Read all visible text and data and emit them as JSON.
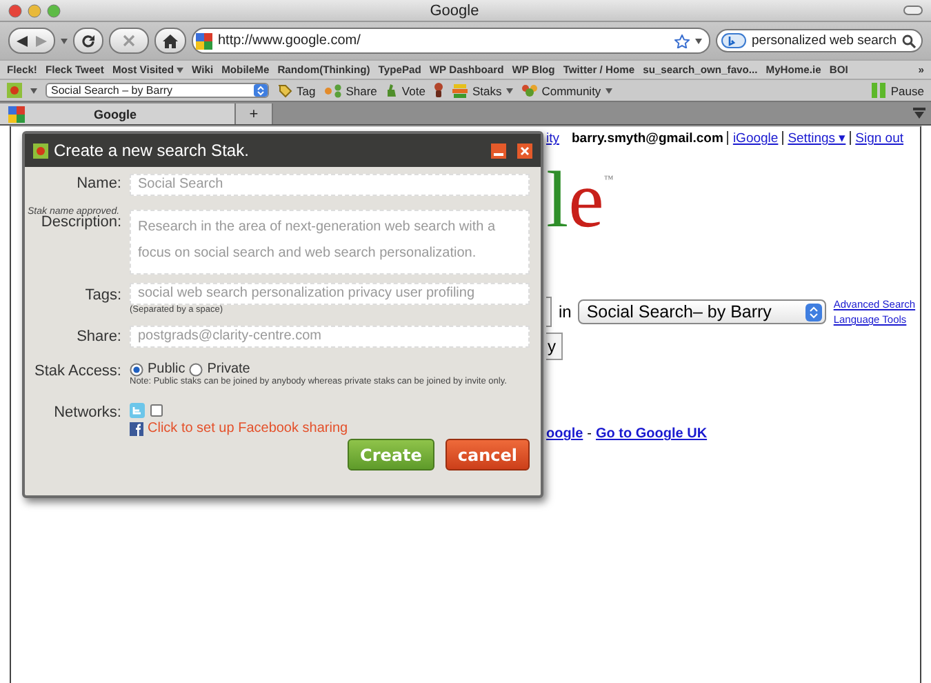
{
  "window": {
    "title": "Google"
  },
  "navigation": {
    "url": "http://www.google.com/",
    "search_value": "personalized web search"
  },
  "bookmarks": [
    {
      "label": "Fleck!",
      "dropdown": false
    },
    {
      "label": "Fleck Tweet",
      "dropdown": false
    },
    {
      "label": "Most Visited",
      "dropdown": true
    },
    {
      "label": "Wiki",
      "dropdown": false
    },
    {
      "label": "MobileMe",
      "dropdown": false
    },
    {
      "label": "Random(Thinking)",
      "dropdown": false
    },
    {
      "label": "TypePad",
      "dropdown": false
    },
    {
      "label": "WP Dashboard",
      "dropdown": false
    },
    {
      "label": "WP Blog",
      "dropdown": false
    },
    {
      "label": "Twitter / Home",
      "dropdown": false
    },
    {
      "label": "su_search_own_favo...",
      "dropdown": false
    },
    {
      "label": "MyHome.ie",
      "dropdown": false
    },
    {
      "label": "BOI",
      "dropdown": false
    }
  ],
  "bookmarks_more": "»",
  "fleck_toolbar": {
    "stak_select": "Social Search – by Barry",
    "buttons": [
      {
        "kind": "tag",
        "label": "Tag",
        "dropdown": false
      },
      {
        "kind": "share",
        "label": "Share",
        "dropdown": false
      },
      {
        "kind": "vote",
        "label": "Vote",
        "dropdown": false
      },
      {
        "kind": "figure",
        "dropdown": false
      },
      {
        "kind": "staks",
        "label": "Staks",
        "dropdown": true
      },
      {
        "kind": "community",
        "label": "Community",
        "dropdown": true
      }
    ],
    "pause": "Pause"
  },
  "tabs": [
    {
      "label": "Google",
      "selected": true
    }
  ],
  "new_tab": "+",
  "page": {
    "top_link_fragment": "ity",
    "account": "barry.smyth@gmail.com",
    "account_links": [
      "iGoogle",
      "Settings ▾",
      "Sign out"
    ],
    "logo_fragment": "le",
    "logo_mark": "™",
    "search_in": "in",
    "stak_select": "Social Search– by Barry",
    "side_links": [
      "Advanced Search",
      "Language Tools"
    ],
    "button_fragment": "y",
    "footer_fragment": "oogle",
    "footer_separator": "-",
    "footer_link": "Go to Google UK"
  },
  "dialog": {
    "title": "Create a new search Stak.",
    "name": {
      "label": "Name:",
      "value": "Social Search",
      "note": "Stak name approved."
    },
    "description": {
      "label": "Description:",
      "value": "Research in the area of next-generation web search with a focus on social search and web search personalization."
    },
    "tags": {
      "label": "Tags:",
      "value": "social web search personalization privacy user profiling",
      "hint": "(Separated by a space)"
    },
    "share": {
      "label": "Share:",
      "value": "postgrads@clarity-centre.com"
    },
    "access": {
      "label": "Stak Access:",
      "options": [
        {
          "label": "Public",
          "selected": true
        },
        {
          "label": "Private",
          "selected": false
        }
      ],
      "note": "Note: Public staks can be joined by anybody whereas private staks can be joined by invite only."
    },
    "networks": {
      "label": "Networks:",
      "twitter_checked": false,
      "facebook_link": "Click to set up Facebook sharing"
    },
    "buttons": [
      {
        "kind": "create",
        "label": "Create"
      },
      {
        "kind": "cancel",
        "label": "cancel"
      }
    ]
  }
}
